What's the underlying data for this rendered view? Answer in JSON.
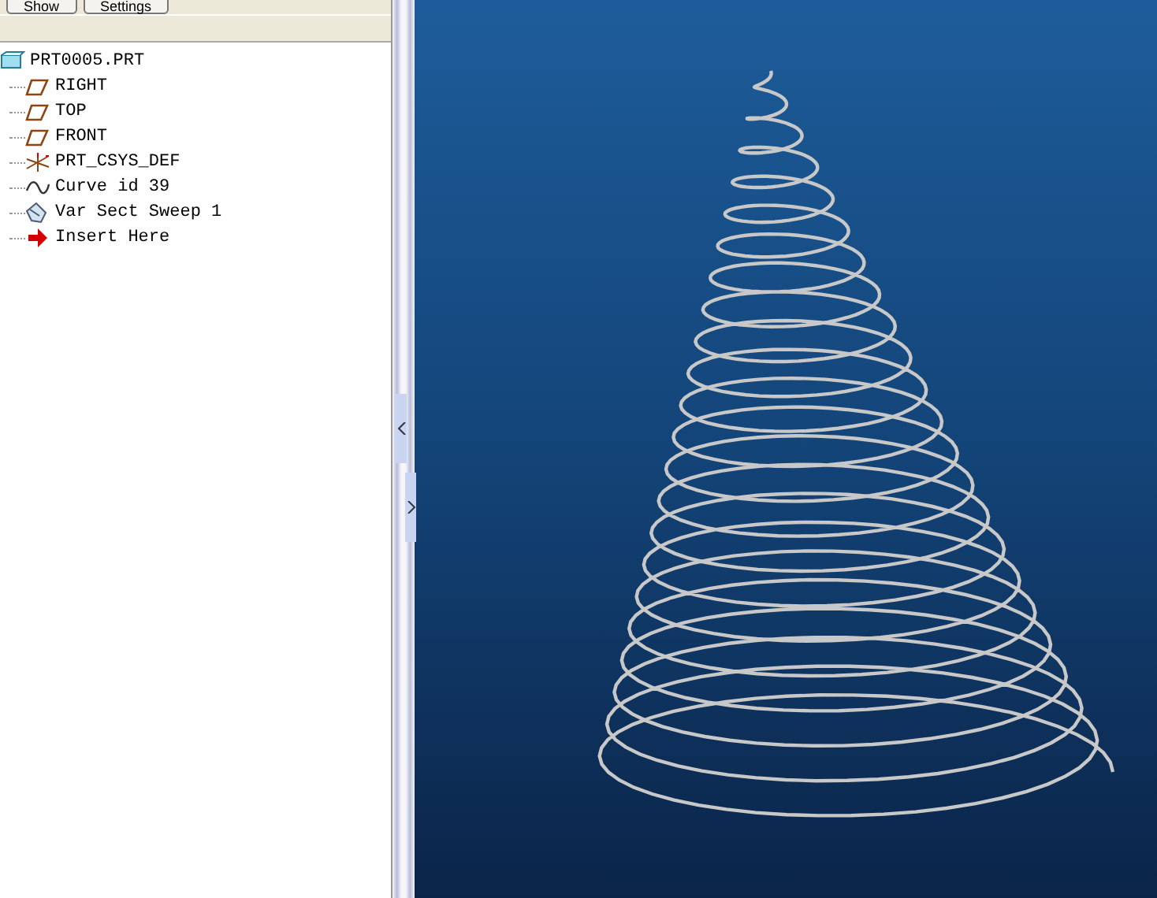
{
  "toolbar": {
    "buttons": [
      "Show",
      "Settings"
    ]
  },
  "model_tree": {
    "root": {
      "label": "PRT0005.PRT",
      "kind": "part",
      "children": [
        {
          "label": "RIGHT",
          "kind": "datum-plane"
        },
        {
          "label": "TOP",
          "kind": "datum-plane"
        },
        {
          "label": "FRONT",
          "kind": "datum-plane"
        },
        {
          "label": "PRT_CSYS_DEF",
          "kind": "csys"
        },
        {
          "label": "Curve id 39",
          "kind": "curve"
        },
        {
          "label": "Var Sect Sweep 1",
          "kind": "sweep"
        },
        {
          "label": "Insert Here",
          "kind": "insert"
        }
      ]
    }
  }
}
